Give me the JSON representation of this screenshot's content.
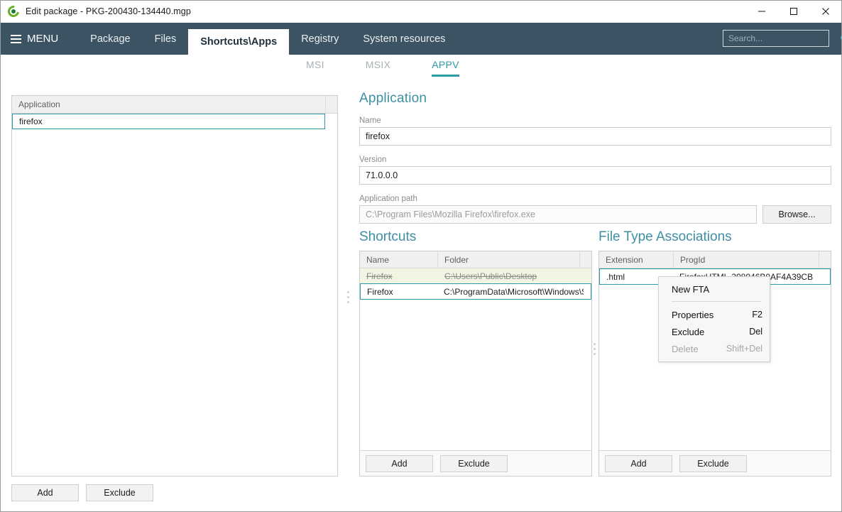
{
  "window": {
    "title": "Edit package - PKG-200430-134440.mgp",
    "icon": "app-logo-icon",
    "controls": {
      "minimize": "—",
      "maximize": "□",
      "close": "✕"
    }
  },
  "menubar": {
    "menu_label": "MENU",
    "tabs": [
      {
        "label": "Package",
        "active": false
      },
      {
        "label": "Files",
        "active": false
      },
      {
        "label": "Shortcuts\\Apps",
        "active": true
      },
      {
        "label": "Registry",
        "active": false
      },
      {
        "label": "System resources",
        "active": false
      }
    ],
    "search": {
      "placeholder": "Search...",
      "value": "",
      "icon": "search-icon"
    }
  },
  "subtabs": [
    {
      "label": "MSI",
      "active": false
    },
    {
      "label": "MSIX",
      "active": false
    },
    {
      "label": "APPV",
      "active": true
    }
  ],
  "application_list": {
    "column_header": "Application",
    "rows": [
      {
        "name": "firefox",
        "selected": true
      }
    ],
    "buttons": {
      "add": "Add",
      "exclude": "Exclude"
    }
  },
  "application_details": {
    "title": "Application",
    "name_label": "Name",
    "name_value": "firefox",
    "version_label": "Version",
    "version_value": "71.0.0.0",
    "path_label": "Application path",
    "path_value": "C:\\Program Files\\Mozilla Firefox\\firefox.exe",
    "browse_button": "Browse..."
  },
  "shortcuts": {
    "title": "Shortcuts",
    "columns": [
      "Name",
      "Folder"
    ],
    "rows": [
      {
        "name": "Firefox",
        "folder": "C:\\Users\\Public\\Desktop",
        "excluded": true,
        "selected": false
      },
      {
        "name": "Firefox",
        "folder": "C:\\ProgramData\\Microsoft\\Windows\\S",
        "excluded": false,
        "selected": true
      }
    ],
    "buttons": {
      "add": "Add",
      "exclude": "Exclude"
    }
  },
  "file_type_associations": {
    "title": "File Type Associations",
    "columns": [
      "Extension",
      "ProgId"
    ],
    "rows": [
      {
        "extension": ".html",
        "progid": "FirefoxHTML-308046B0AF4A39CB",
        "selected": true
      }
    ],
    "buttons": {
      "add": "Add",
      "exclude": "Exclude"
    }
  },
  "context_menu": {
    "items": [
      {
        "label": "New FTA",
        "accelerator": "",
        "disabled": false,
        "separator_after": true
      },
      {
        "label": "Properties",
        "accelerator": "F2",
        "disabled": false,
        "separator_after": false
      },
      {
        "label": "Exclude",
        "accelerator": "Del",
        "disabled": false,
        "separator_after": false
      },
      {
        "label": "Delete",
        "accelerator": "Shift+Del",
        "disabled": true,
        "separator_after": false
      }
    ]
  },
  "colors": {
    "menubar_bg": "#3b5362",
    "accent_teal": "#2e9aa8",
    "section_title": "#3e8fa3",
    "excluded_row_bg": "#f4f4e2",
    "logo_green": "#6ab023"
  }
}
